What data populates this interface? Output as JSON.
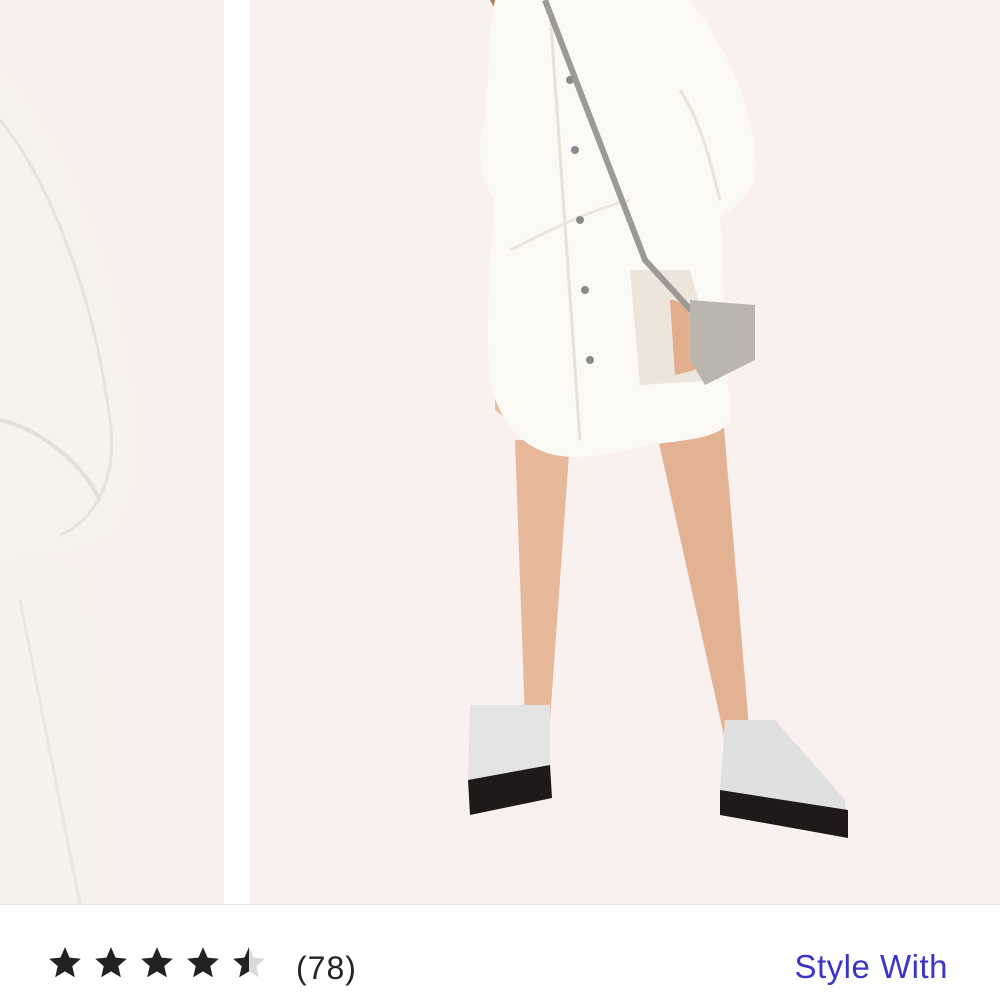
{
  "gallery": {
    "images": [
      {
        "name": "product-photo-detail",
        "alt": ""
      },
      {
        "name": "product-photo-model",
        "alt": ""
      }
    ]
  },
  "rating": {
    "value": 4.5,
    "max": 5,
    "icon": "star-icon",
    "review_count": "(78)",
    "star_color": "#222222"
  },
  "actions": {
    "style_with_label": "Style With",
    "link_color": "#3a34c8"
  }
}
